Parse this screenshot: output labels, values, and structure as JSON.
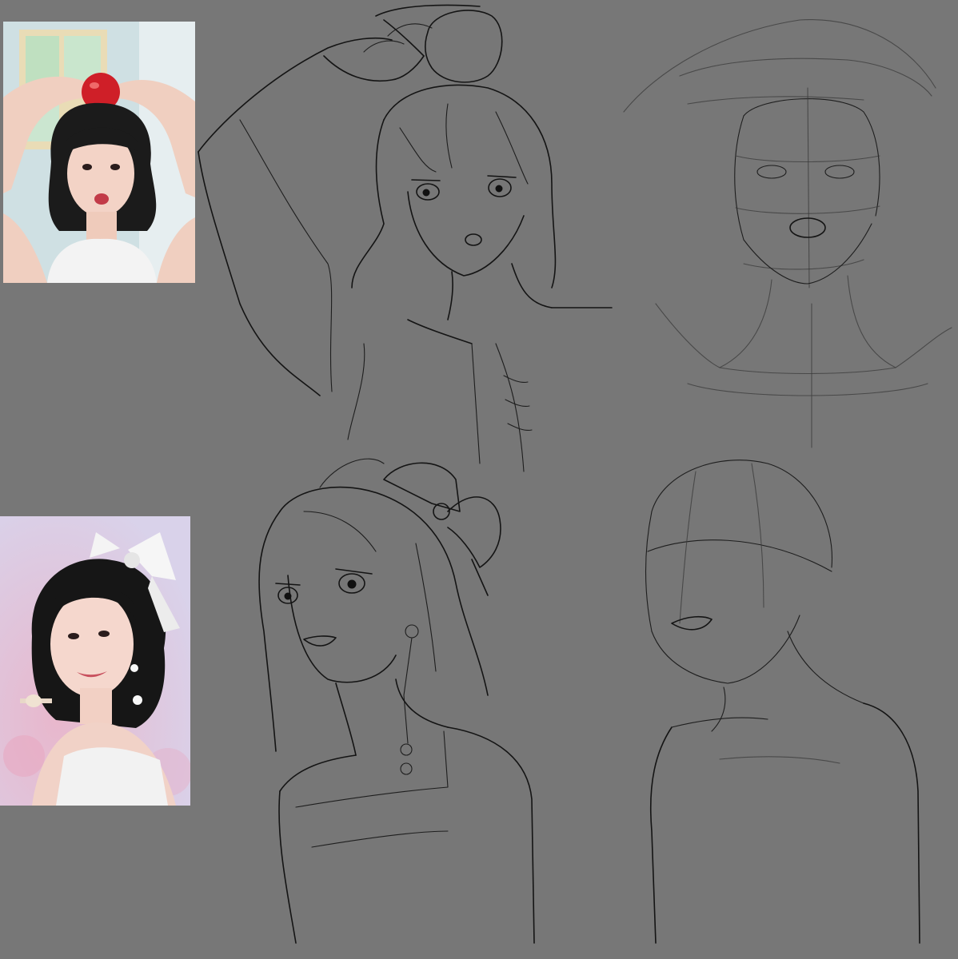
{
  "canvas": {
    "background": "#777777"
  },
  "references": [
    {
      "name": "reference-photo-apple",
      "description_colors": {
        "wall": "#cfe3e8",
        "window": "#e8d9b0",
        "apple": "#d4222a",
        "hair": "#1a1a1a",
        "top": "#f2f2f2"
      }
    },
    {
      "name": "reference-photo-bow",
      "description_colors": {
        "background": "#d8c6df",
        "bow": "#f4f4f4",
        "hair": "#141414",
        "lace": "#efefef"
      }
    }
  ],
  "sketches": [
    {
      "name": "sketch-apple-lineart",
      "style": "clean line art"
    },
    {
      "name": "sketch-apple-construction",
      "style": "construction lines"
    },
    {
      "name": "sketch-bow-lineart",
      "style": "clean line art"
    },
    {
      "name": "sketch-bow-construction",
      "style": "construction lines"
    }
  ]
}
